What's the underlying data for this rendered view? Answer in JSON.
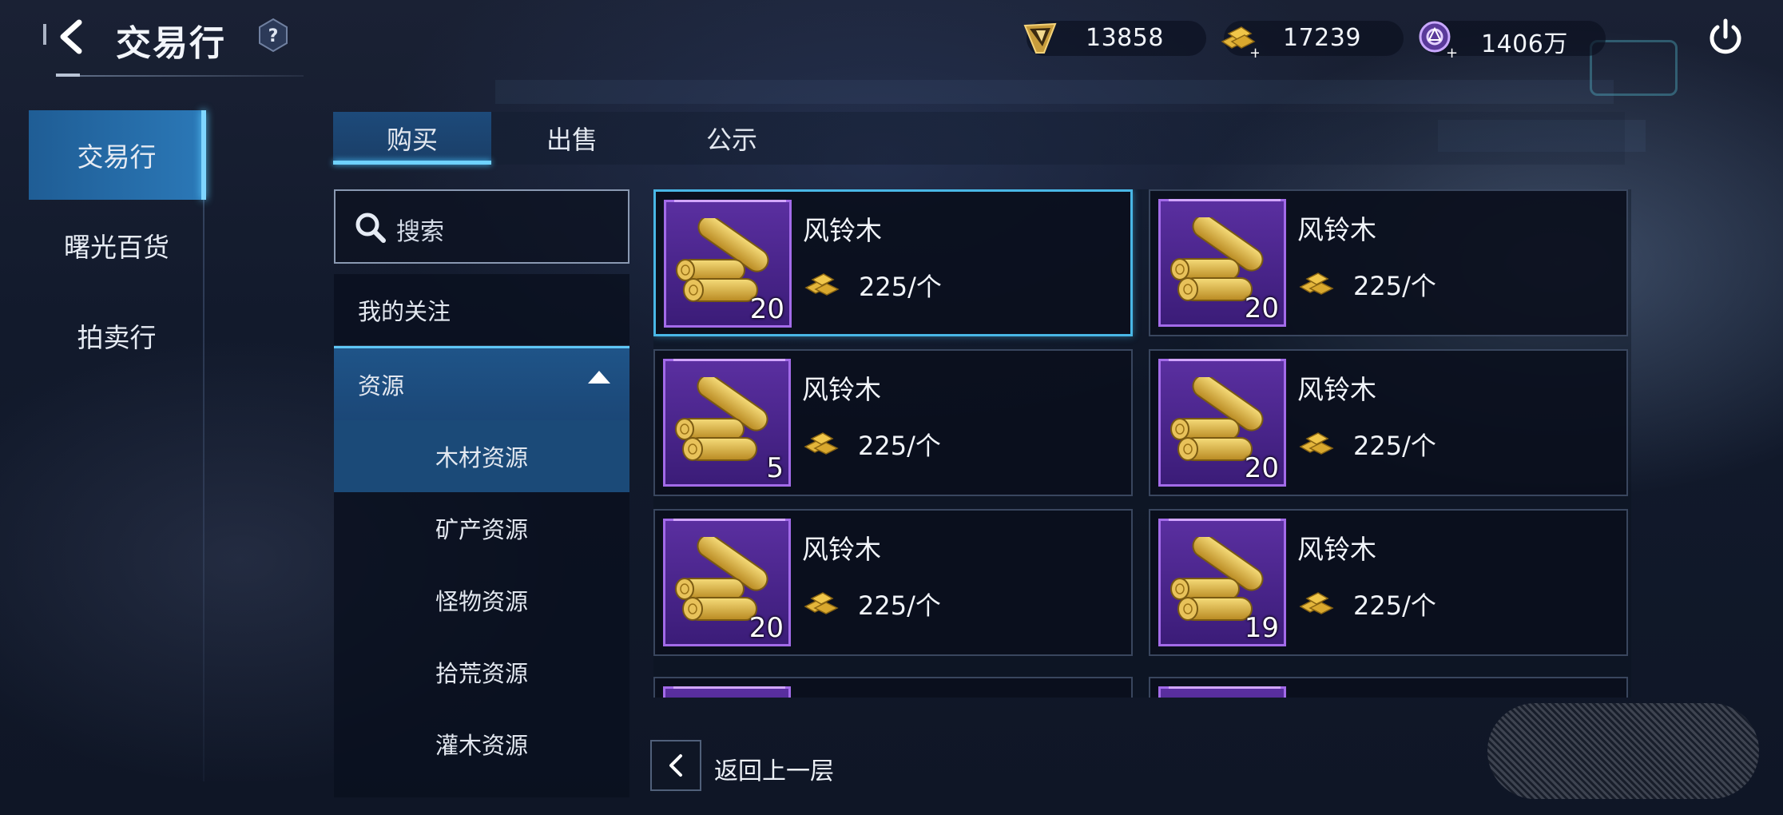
{
  "header": {
    "title": "交易行",
    "help_label": "?",
    "currencies": [
      {
        "icon": "crystal-shard-icon",
        "value": "13858"
      },
      {
        "icon": "gold-bars-plus-icon",
        "value": "17239"
      },
      {
        "icon": "purple-coin-plus-icon",
        "value": "1406万"
      }
    ]
  },
  "left_nav": {
    "items": [
      {
        "label": "交易行",
        "active": true
      },
      {
        "label": "曙光百货",
        "active": false
      },
      {
        "label": "拍卖行",
        "active": false
      }
    ]
  },
  "tabs": [
    {
      "label": "购买",
      "active": true
    },
    {
      "label": "出售",
      "active": false
    },
    {
      "label": "公示",
      "active": false
    }
  ],
  "search": {
    "placeholder": "搜索"
  },
  "categories": {
    "favorites": "我的关注",
    "group": {
      "label": "资源",
      "expanded": true
    },
    "subitems": [
      {
        "label": "木材资源",
        "selected": true
      },
      {
        "label": "矿产资源",
        "selected": false
      },
      {
        "label": "怪物资源",
        "selected": false
      },
      {
        "label": "拾荒资源",
        "selected": false
      },
      {
        "label": "灌木资源",
        "selected": false
      }
    ]
  },
  "listings": [
    {
      "name": "风铃木",
      "quantity": "20",
      "price": "225/个",
      "selected": true
    },
    {
      "name": "风铃木",
      "quantity": "20",
      "price": "225/个",
      "selected": false
    },
    {
      "name": "风铃木",
      "quantity": "5",
      "price": "225/个",
      "selected": false
    },
    {
      "name": "风铃木",
      "quantity": "20",
      "price": "225/个",
      "selected": false
    },
    {
      "name": "风铃木",
      "quantity": "20",
      "price": "225/个",
      "selected": false
    },
    {
      "name": "风铃木",
      "quantity": "19",
      "price": "225/个",
      "selected": false
    }
  ],
  "footer": {
    "back_label": "返回上一层"
  },
  "colors": {
    "accent": "#49b7e6",
    "tab_active": "#1d4a7a",
    "item_frame": "#5a2fa0"
  }
}
